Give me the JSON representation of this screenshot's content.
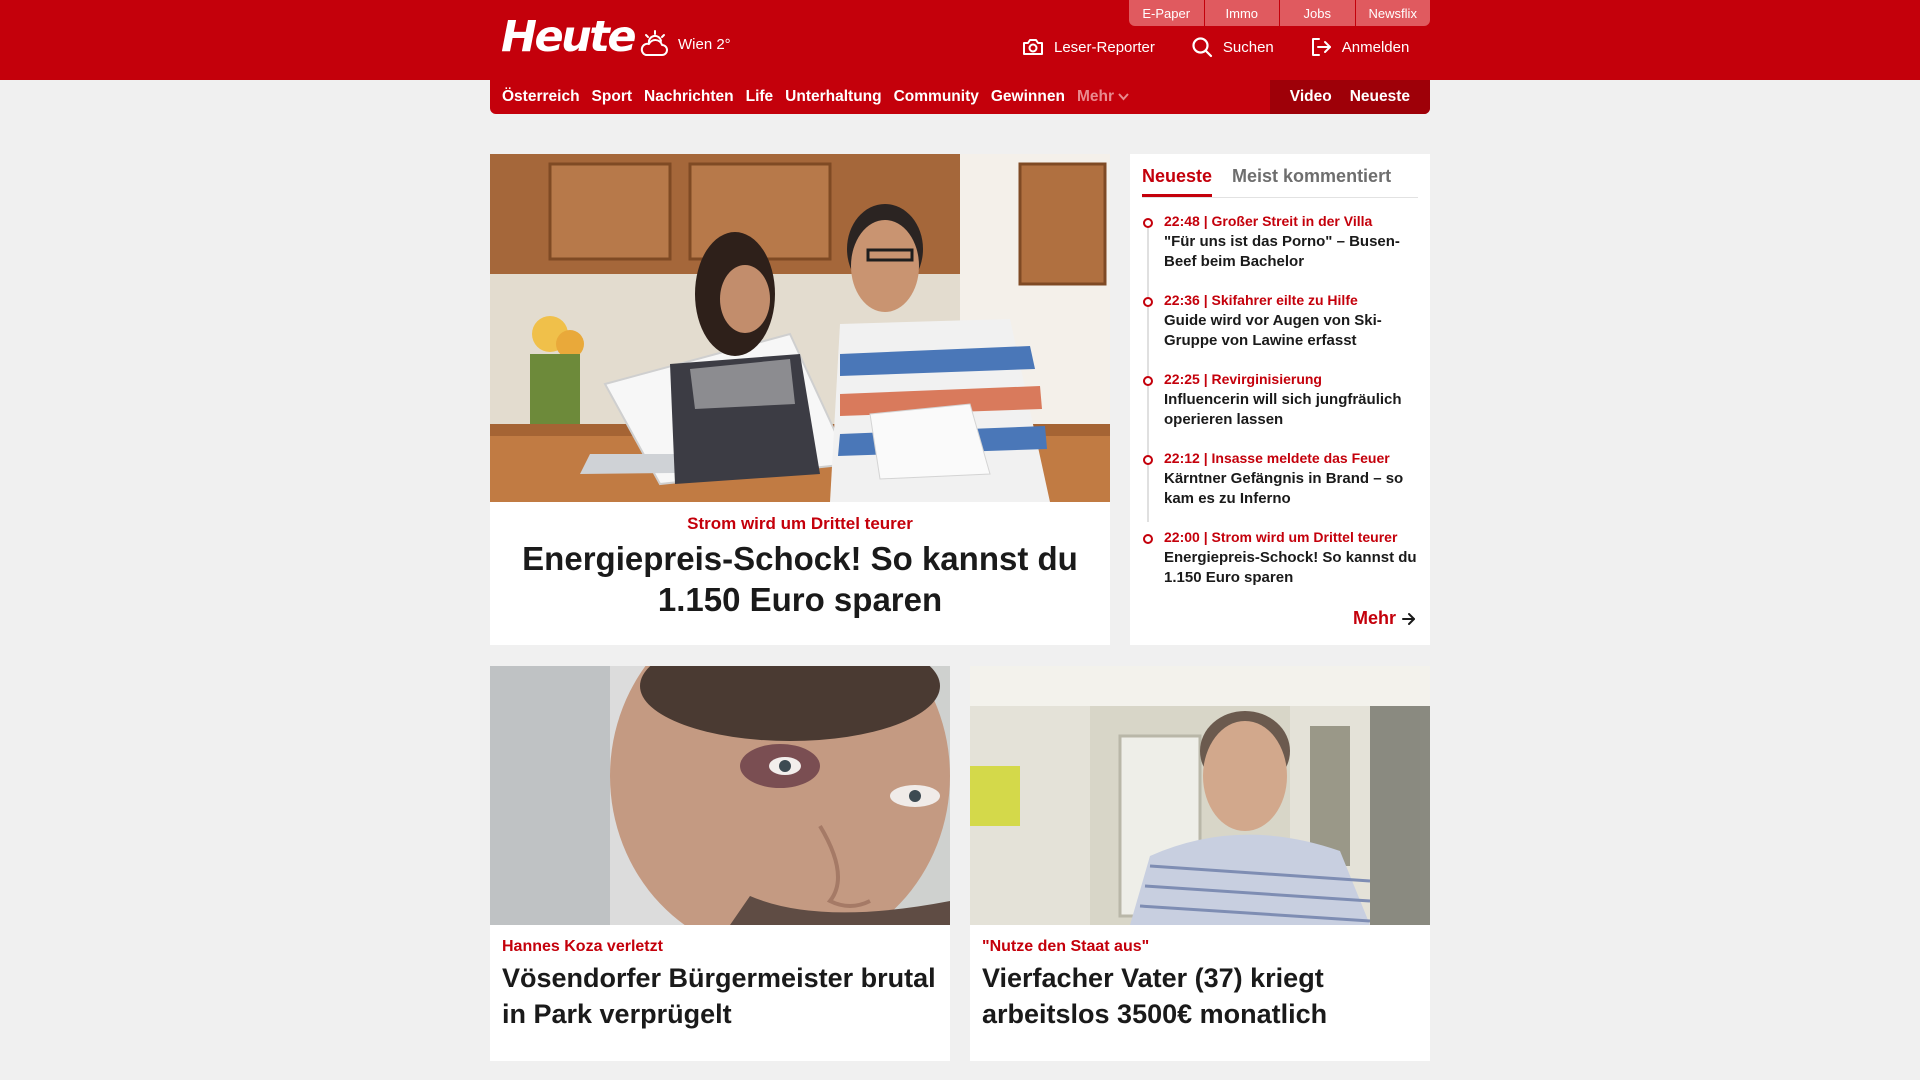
{
  "colors": {
    "brand_red": "#c4000b",
    "dark_red": "#9e0008",
    "background": "#f0f0f0"
  },
  "top_links": [
    "E-Paper",
    "Immo",
    "Jobs",
    "Newsflix"
  ],
  "header": {
    "logo": "Heute",
    "weather": {
      "icon": "cloud-sun-icon",
      "text": "Wien 2°"
    },
    "actions": [
      {
        "icon": "camera-icon",
        "label": "Leser-Reporter"
      },
      {
        "icon": "search-icon",
        "label": "Suchen"
      },
      {
        "icon": "login-icon",
        "label": "Anmelden"
      }
    ]
  },
  "nav": {
    "items": [
      "Österreich",
      "Sport",
      "Nachrichten",
      "Life",
      "Unterhaltung",
      "Community",
      "Gewinnen"
    ],
    "more": "Mehr",
    "right": [
      "Video",
      "Neueste"
    ]
  },
  "hero": {
    "kicker": "Strom wird um Drittel teurer",
    "title": "Energiepreis-Schock! So kannst du 1.150 Euro sparen"
  },
  "sidebar": {
    "tabs": [
      "Neueste",
      "Meist kommentiert"
    ],
    "items": [
      {
        "meta": "22:48 | Großer Streit in der Villa",
        "title": "\"Für uns ist das Porno\" – Busen-Beef beim Bachelor"
      },
      {
        "meta": "22:36 | Skifahrer eilte zu Hilfe",
        "title": "Guide wird vor Augen von Ski-Gruppe von Lawine erfasst"
      },
      {
        "meta": "22:25 | Revirginisierung",
        "title": "Influencerin will sich jungfräulich operieren lassen"
      },
      {
        "meta": "22:12 | Insasse meldete das Feuer",
        "title": "Kärntner Gefängnis in Brand – so kam es zu Inferno"
      },
      {
        "meta": "22:00 | Strom wird um Drittel teurer",
        "title": "Energiepreis-Schock! So kannst du 1.150 Euro sparen"
      }
    ],
    "more": "Mehr"
  },
  "cards": [
    {
      "kicker": "Hannes Koza verletzt",
      "title": "Vösendorfer Bürgermeister brutal in Park verprügelt"
    },
    {
      "kicker": "\"Nutze den Staat aus\"",
      "title": "Vierfacher Vater (37) kriegt arbeitslos 3500€ monatlich"
    }
  ]
}
